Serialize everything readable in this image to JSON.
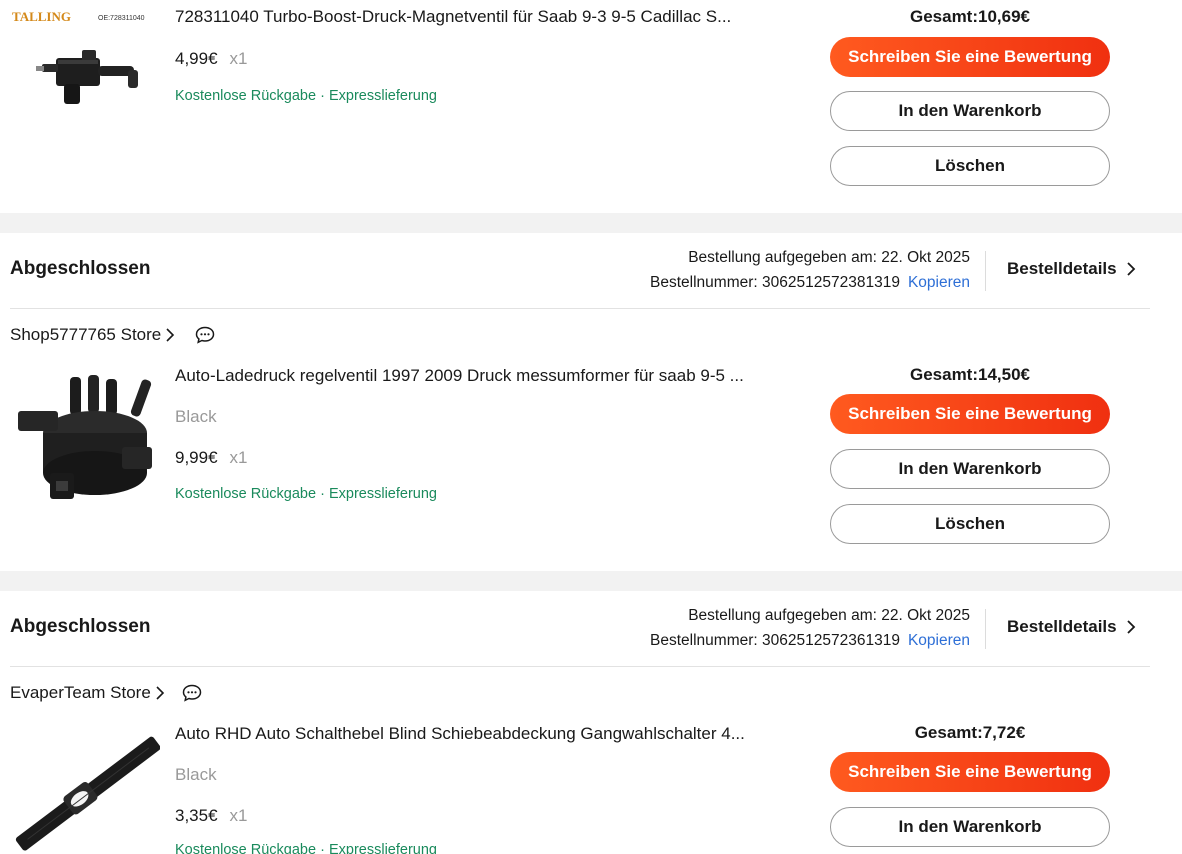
{
  "orders": [
    {
      "product": {
        "title": "728311040 Turbo-Boost-Druck-Magnetventil für Saab 9-3 9-5 Cadillac S...",
        "price": "4,99€",
        "qty": "x1",
        "perk1": "Kostenlose Rückgabe",
        "perk_sep": "·",
        "perk2": "Expresslieferung",
        "image_brand": "TALLING",
        "image_oe": "OE:728311040"
      },
      "total": "Gesamt:10,69€",
      "buttons": {
        "review": "Schreiben Sie eine Bewertung",
        "cart": "In den Warenkorb",
        "delete": "Löschen"
      }
    },
    {
      "status": "Abgeschlossen",
      "date_line": "Bestellung aufgegeben am: 22. Okt 2025",
      "order_line": "Bestellnummer: 3062512572381319",
      "copy": "Kopieren",
      "details": "Bestelldetails",
      "store": "Shop5777765 Store",
      "product": {
        "title": "Auto-Ladedruck regelventil 1997 2009 Druck messumformer für saab 9-5 ...",
        "variant": "Black",
        "price": "9,99€",
        "qty": "x1",
        "perk1": "Kostenlose Rückgabe",
        "perk_sep": "·",
        "perk2": "Expresslieferung"
      },
      "total": "Gesamt:14,50€",
      "buttons": {
        "review": "Schreiben Sie eine Bewertung",
        "cart": "In den Warenkorb",
        "delete": "Löschen"
      }
    },
    {
      "status": "Abgeschlossen",
      "date_line": "Bestellung aufgegeben am: 22. Okt 2025",
      "order_line": "Bestellnummer: 3062512572361319",
      "copy": "Kopieren",
      "details": "Bestelldetails",
      "store": "EvaperTeam Store",
      "product": {
        "title": "Auto RHD Auto Schalthebel Blind Schiebeabdeckung Gangwahlschalter 4...",
        "variant": "Black",
        "price": "3,35€",
        "qty": "x1",
        "perk1": "Kostenlose Rückgabe",
        "perk_sep": "·",
        "perk2": "Expresslieferung"
      },
      "total": "Gesamt:7,72€",
      "buttons": {
        "review": "Schreiben Sie eine Bewertung",
        "cart": "In den Warenkorb"
      }
    }
  ],
  "colors": {
    "accent": "#ff5a1f",
    "perk_green": "#1a8a5c",
    "link_blue": "#2e6fd6",
    "section_gap": "#f2f2f2"
  }
}
